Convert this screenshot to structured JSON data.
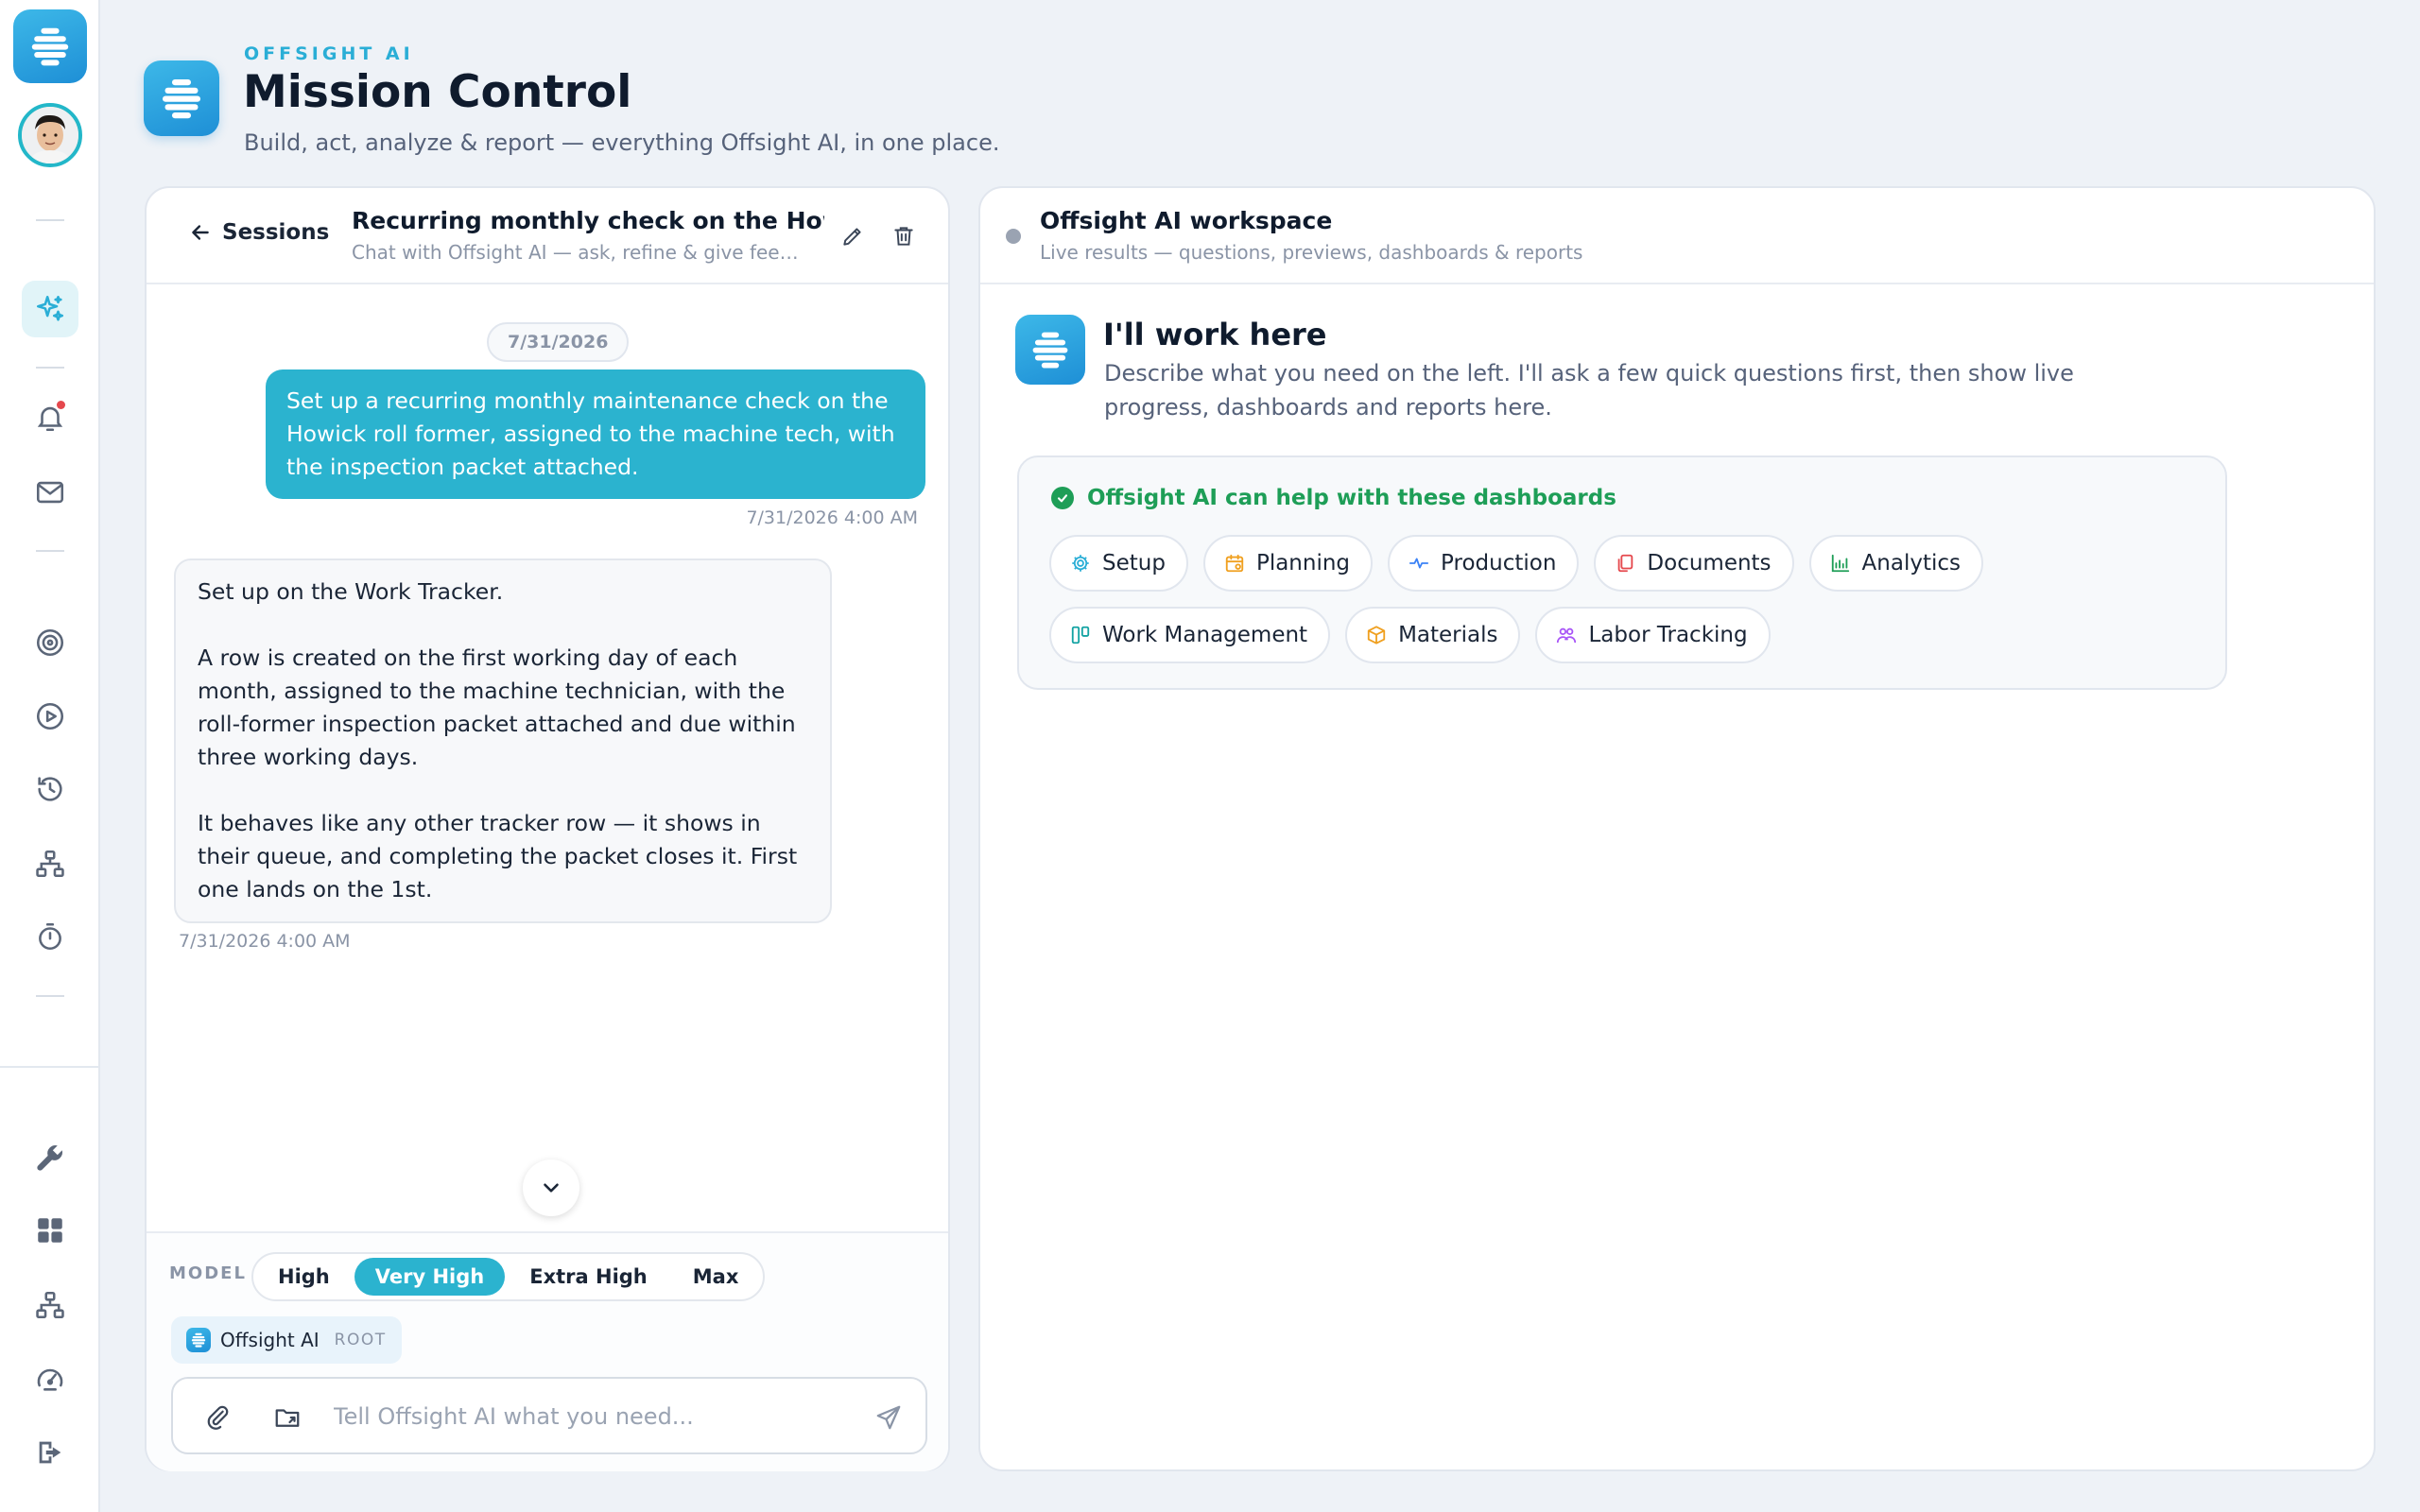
{
  "brand": {
    "eyebrow": "OFFSIGHT AI",
    "title": "Mission Control",
    "subtitle": "Build, act, analyze & report — everything Offsight AI, in one place."
  },
  "sidebar": {
    "icons": [
      "sparkles-icon",
      "bell-icon",
      "mail-icon",
      "target-icon",
      "play-icon",
      "history-icon",
      "network-icon",
      "timer-icon",
      "wrench-icon",
      "grid-icon",
      "hierarchy-icon",
      "gauge-icon",
      "logout-icon"
    ],
    "notification_color": "#e5484d"
  },
  "session": {
    "back_label": "Sessions",
    "title": "Recurring monthly check on the Howick",
    "subtitle": "Chat with Offsight AI — ask, refine & give feedback",
    "date_divider": "7/31/2026",
    "messages": [
      {
        "role": "user",
        "text": "Set up a recurring monthly maintenance check on the Howick roll former, assigned to the machine tech, with the inspection packet attached.",
        "time": "7/31/2026 4:00 AM"
      },
      {
        "role": "assistant",
        "paragraphs": [
          "Set up on the Work Tracker.",
          "A row is created on the first working day of each month, assigned to the machine technician, with the roll-former inspection packet attached and due within three working days.",
          "It behaves like any other tracker row — it shows in their queue, and completing the packet closes it. First one lands on the 1st."
        ],
        "time": "7/31/2026 4:00 AM"
      }
    ]
  },
  "composer": {
    "model_label": "MODEL",
    "models": [
      "High",
      "Very High",
      "Extra High",
      "Max"
    ],
    "selected_model": "Very High",
    "agent_name": "Offsight AI",
    "agent_scope": "ROOT",
    "placeholder": "Tell Offsight AI what you need..."
  },
  "workspace": {
    "title": "Offsight AI workspace",
    "subtitle": "Live results — questions, previews, dashboards & reports",
    "heading": "I'll work here",
    "description": "Describe what you need on the left. I'll ask a few quick questions first, then show live progress, dashboards and reports here.",
    "dashboards_heading": "Offsight AI can help with these dashboards",
    "dashboards": [
      {
        "label": "Setup",
        "icon": "gear-icon",
        "color": "#2aaed6"
      },
      {
        "label": "Planning",
        "icon": "calendar-icon",
        "color": "#f0a020"
      },
      {
        "label": "Production",
        "icon": "pulse-icon",
        "color": "#3b82f6"
      },
      {
        "label": "Documents",
        "icon": "documents-icon",
        "color": "#e5484d"
      },
      {
        "label": "Analytics",
        "icon": "chart-icon",
        "color": "#1e9e57"
      },
      {
        "label": "Work Management",
        "icon": "kanban-icon",
        "color": "#14a3a3"
      },
      {
        "label": "Materials",
        "icon": "box-icon",
        "color": "#f0a020"
      },
      {
        "label": "Labor Tracking",
        "icon": "people-icon",
        "color": "#a855f7"
      }
    ]
  },
  "colors": {
    "accent": "#2bb3cf",
    "success": "#1e9e57",
    "brand": "#1e8fd6"
  }
}
